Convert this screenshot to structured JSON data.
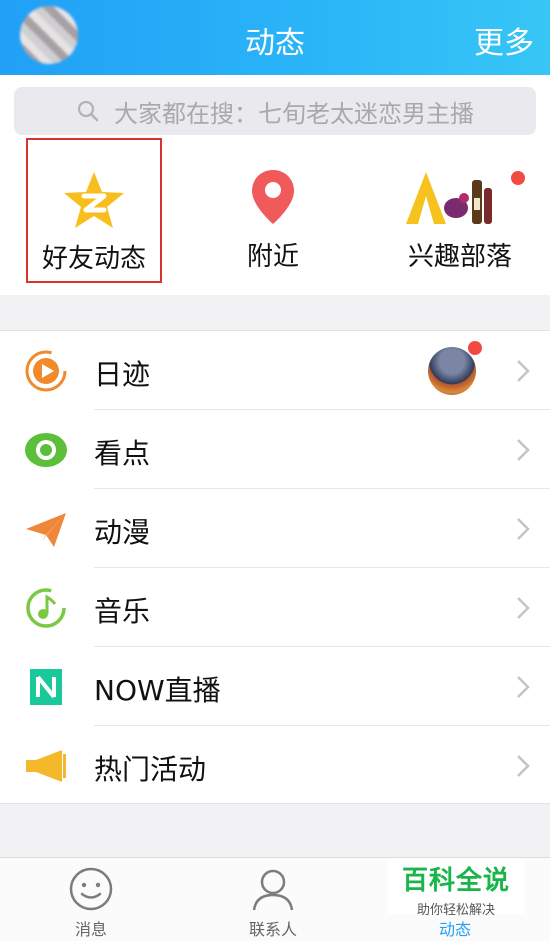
{
  "header": {
    "title": "动态",
    "more": "更多"
  },
  "search": {
    "placeholder": "大家都在搜：七旬老太迷恋男主播"
  },
  "shortcuts": [
    {
      "label": "好友动态",
      "icon": "qzone-star-icon"
    },
    {
      "label": "附近",
      "icon": "location-pin-icon"
    },
    {
      "label": "兴趣部落",
      "icon": "tent-icon"
    }
  ],
  "list": [
    {
      "label": "日迹",
      "icon": "play-circle-icon",
      "color": "#f08a2a"
    },
    {
      "label": "看点",
      "icon": "eye-icon",
      "color": "#5bbf3a"
    },
    {
      "label": "动漫",
      "icon": "paper-plane-icon",
      "color": "#f0863a"
    },
    {
      "label": "音乐",
      "icon": "music-note-icon",
      "color": "#7ac943"
    },
    {
      "label": "NOW直播",
      "icon": "now-logo-icon",
      "color": "#1bc89a"
    },
    {
      "label": "热门活动",
      "icon": "megaphone-icon",
      "color": "#f4b92a"
    }
  ],
  "tabs": [
    {
      "label": "消息",
      "icon": "smiley-icon"
    },
    {
      "label": "联系人",
      "icon": "person-icon"
    },
    {
      "label": "动态",
      "icon": "star-icon",
      "active": true
    }
  ],
  "watermark": {
    "title": "百科全说",
    "subtitle": "助你轻松解决"
  },
  "colors": {
    "accent": "#21a0f6",
    "highlight_box": "#d9342b",
    "badge": "#f24a41"
  }
}
